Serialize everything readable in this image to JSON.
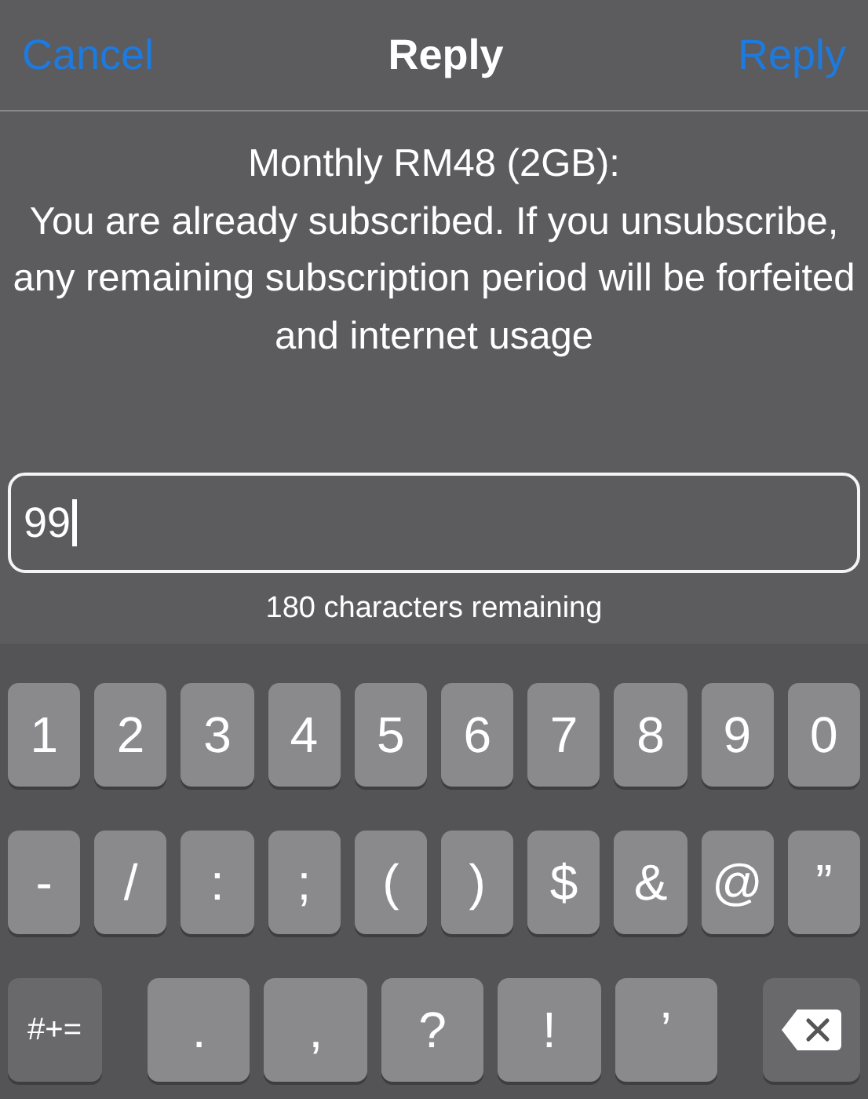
{
  "nav_bar": {
    "cancel": "Cancel",
    "title": "Reply",
    "send": "Reply"
  },
  "message": "Monthly RM48 (2GB):\nYou are already subscribed. If you unsubscribe, any remaining subscription period will be forfeited and internet usage",
  "reply_field": {
    "value": "99",
    "focused": true
  },
  "counter": "180 characters remaining",
  "keyboard": {
    "rows": [
      [
        {
          "kind": "char",
          "label": "1"
        },
        {
          "kind": "char",
          "label": "2"
        },
        {
          "kind": "char",
          "label": "3"
        },
        {
          "kind": "char",
          "label": "4"
        },
        {
          "kind": "char",
          "label": "5"
        },
        {
          "kind": "char",
          "label": "6"
        },
        {
          "kind": "char",
          "label": "7"
        },
        {
          "kind": "char",
          "label": "8"
        },
        {
          "kind": "char",
          "label": "9"
        },
        {
          "kind": "char",
          "label": "0"
        }
      ],
      [
        {
          "kind": "char",
          "label": "-"
        },
        {
          "kind": "char",
          "label": "/"
        },
        {
          "kind": "char",
          "label": ":"
        },
        {
          "kind": "char",
          "label": ";"
        },
        {
          "kind": "char",
          "label": "("
        },
        {
          "kind": "char",
          "label": ")"
        },
        {
          "kind": "char",
          "label": "$"
        },
        {
          "kind": "char",
          "label": "&"
        },
        {
          "kind": "char",
          "label": "@"
        },
        {
          "kind": "char",
          "label": "”"
        }
      ],
      [
        {
          "kind": "mode",
          "label": "#+="
        },
        {
          "kind": "char",
          "label": "."
        },
        {
          "kind": "char",
          "label": ","
        },
        {
          "kind": "char",
          "label": "?"
        },
        {
          "kind": "char",
          "label": "!"
        },
        {
          "kind": "char",
          "label": "’"
        },
        {
          "kind": "delete"
        }
      ]
    ]
  }
}
